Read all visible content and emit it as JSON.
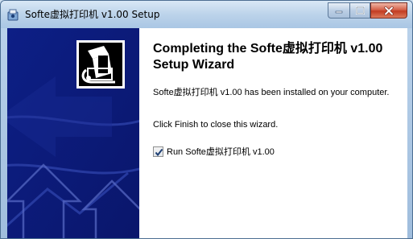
{
  "window": {
    "title": "Softe虚拟打印机 v1.00 Setup",
    "controls": {
      "minimize_icon": "minimize-icon",
      "maximize_icon": "maximize-icon",
      "close_icon": "close-icon"
    }
  },
  "wizard": {
    "heading": "Completing the Softe虚拟打印机 v1.00 Setup Wizard",
    "installed_text": "Softe虚拟打印机 v1.00 has been installed on your computer.",
    "finish_text": "Click Finish to close this wizard.",
    "run_option": {
      "label": "Run Softe虚拟打印机 v1.00",
      "checked": true
    }
  },
  "colors": {
    "banner": "#0b1a7c",
    "close_button": "#c23c22",
    "titlebar": "#bcd3ea"
  }
}
